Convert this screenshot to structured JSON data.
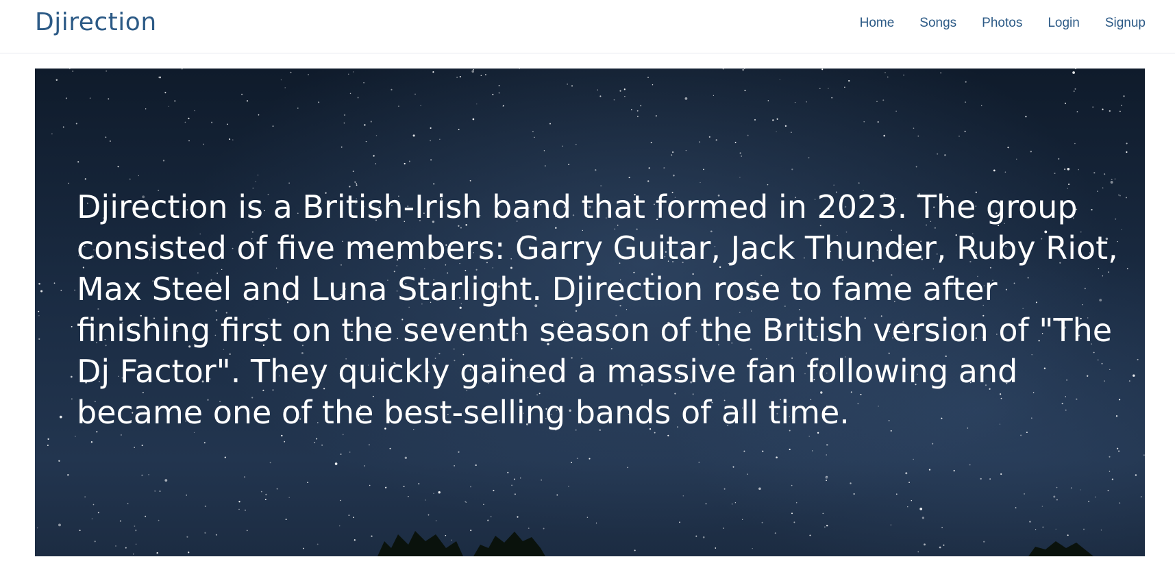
{
  "navbar": {
    "brand": "Djirection",
    "links": [
      "Home",
      "Songs",
      "Photos",
      "Login",
      "Signup"
    ]
  },
  "hero": {
    "text": "Djirection is a British-Irish band that formed in 2023. The group consisted of five members: Garry Guitar, Jack Thunder, Ruby Riot, Max Steel and Luna Starlight. Djirection rose to fame after finishing first on the seventh season of the British version of \"The Dj Factor\". They quickly gained a massive fan following and became one of the best-selling bands of all time.",
    "background": "night-sky-stars-image"
  },
  "colors": {
    "brand": "#2c5a86",
    "nav_link": "#2c5a86",
    "hero_text": "#ffffff",
    "hero_bg": "#1a2b42"
  }
}
